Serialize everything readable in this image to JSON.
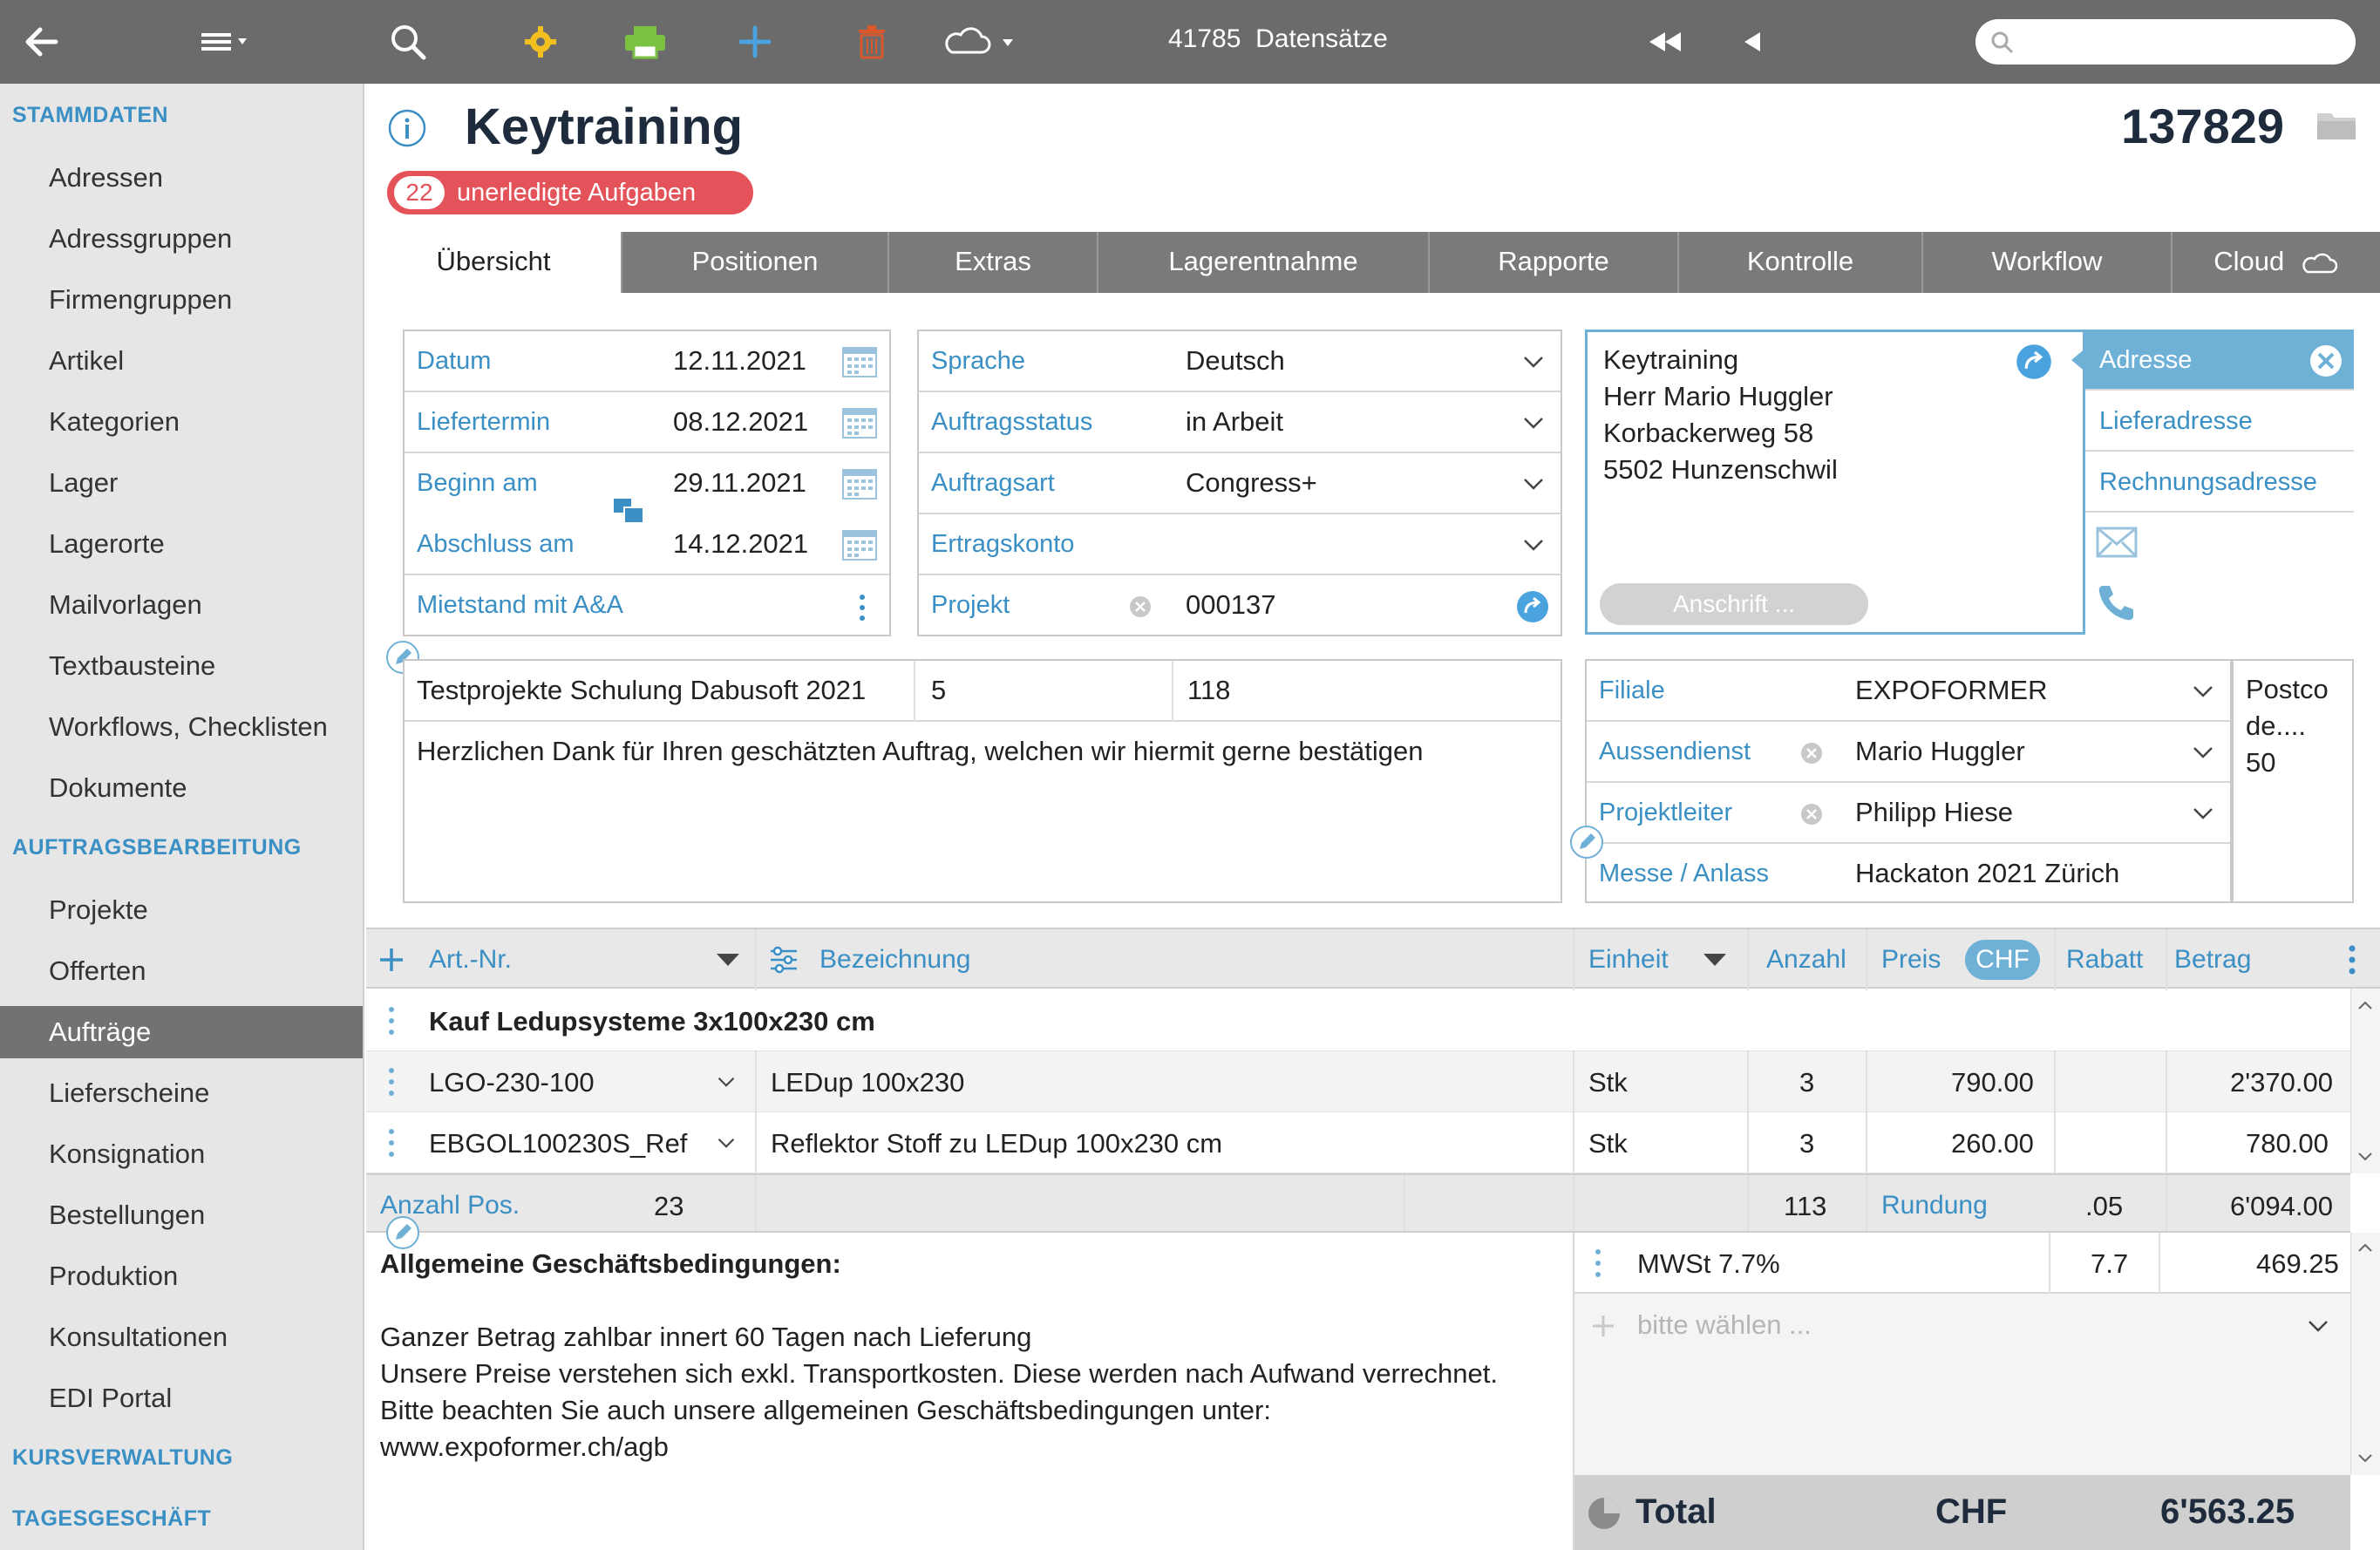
{
  "toolbar": {
    "record_count": "41785",
    "records_label": "Datensätze",
    "search_placeholder": ""
  },
  "sidebar": {
    "sections": [
      {
        "title": "STAMMDATEN",
        "items": [
          "Adressen",
          "Adressgruppen",
          "Firmengruppen",
          "Artikel",
          "Kategorien",
          "Lager",
          "Lagerorte",
          "Mailvorlagen",
          "Textbausteine",
          "Workflows, Checklisten",
          "Dokumente"
        ]
      },
      {
        "title": "AUFTRAGSBEARBEITUNG",
        "items": [
          "Projekte",
          "Offerten",
          "Aufträge",
          "Lieferscheine",
          "Konsignation",
          "Bestellungen",
          "Produktion",
          "Konsultationen",
          "EDI Portal"
        ]
      },
      {
        "title": "KURSVERWALTUNG",
        "items": []
      },
      {
        "title": "TAGESGESCHÄFT",
        "items": []
      }
    ],
    "active_item": "Aufträge"
  },
  "header": {
    "title": "Keytraining",
    "record_id": "137829",
    "tasks_count": "22",
    "tasks_label": "unerledigte Aufgaben"
  },
  "tabs": [
    "Übersicht",
    "Positionen",
    "Extras",
    "Lagerentnahme",
    "Rapporte",
    "Kontrolle",
    "Workflow",
    "Cloud"
  ],
  "dates": [
    {
      "label": "Datum",
      "value": "12.11.2021"
    },
    {
      "label": "Liefertermin",
      "value": "08.12.2021"
    },
    {
      "label": "Beginn am",
      "value": "29.11.2021"
    },
    {
      "label": "Abschluss am",
      "value": "14.12.2021"
    }
  ],
  "mietstand_label": "Mietstand mit A&A",
  "selects": [
    {
      "label": "Sprache",
      "value": "Deutsch"
    },
    {
      "label": "Auftragsstatus",
      "value": "in Arbeit"
    },
    {
      "label": "Auftragsart",
      "value": "Congress+"
    },
    {
      "label": "Ertragskonto",
      "value": ""
    }
  ],
  "projekt": {
    "label": "Projekt",
    "value": "000137"
  },
  "address": {
    "lines": [
      "Keytraining",
      "Herr Mario Huggler",
      "Korbackerweg 58",
      "5502 Hunzenschwil"
    ],
    "button": "Anschrift ...",
    "tabs": [
      "Adresse",
      "Lieferadresse",
      "Rechnungsadresse"
    ]
  },
  "project_line": {
    "name": "Testprojekte Schulung Dabusoft 2021",
    "num1": "5",
    "num2": "118"
  },
  "intro_text": "Herzlichen Dank für Ihren geschätzten Auftrag, welchen wir hiermit gerne bestätigen",
  "staff": [
    {
      "label": "Filiale",
      "value": "EXPOFORMER"
    },
    {
      "label": "Aussendienst",
      "value": "Mario Huggler"
    },
    {
      "label": "Projektleiter",
      "value": "Philipp Hiese"
    },
    {
      "label": "Messe / Anlass",
      "value": "Hackaton 2021 Zürich"
    }
  ],
  "postcode_note": [
    "Postco",
    "de....",
    "50"
  ],
  "positions": {
    "headers": {
      "artnr": "Art.-Nr.",
      "bez": "Bezeichnung",
      "einheit": "Einheit",
      "anzahl": "Anzahl",
      "preis": "Preis",
      "currency": "CHF",
      "rabatt": "Rabatt",
      "betrag": "Betrag"
    },
    "group_title": "Kauf Ledupsysteme 3x100x230 cm",
    "rows": [
      {
        "artnr": "LGO-230-100",
        "bez": "LEDup 100x230",
        "einheit": "Stk",
        "anzahl": "3",
        "preis": "790.00",
        "betrag": "2'370.00"
      },
      {
        "artnr": "EBGOL100230S_Ref",
        "bez": "Reflektor Stoff zu LEDup 100x230 cm",
        "einheit": "Stk",
        "anzahl": "3",
        "preis": "260.00",
        "betrag": "780.00"
      }
    ],
    "footer": {
      "count_label": "Anzahl Pos.",
      "count": "23",
      "qty_total": "113",
      "rundung_label": "Rundung",
      "rundung": ".05",
      "subtotal": "6'094.00"
    }
  },
  "agb": {
    "title": "Allgemeine Geschäftsbedingungen:",
    "lines": [
      "Ganzer Betrag zahlbar innert 60 Tagen nach Lieferung",
      "Unsere Preise verstehen sich exkl. Transportkosten. Diese werden nach Aufwand verrechnet.",
      "Bitte beachten Sie auch unsere allgemeinen Geschäftsbedingungen unter:",
      "www.expoformer.ch/agb"
    ]
  },
  "tax": {
    "label": "MWSt 7.7%",
    "rate": "7.7",
    "amount": "469.25",
    "add_placeholder": "bitte wählen ..."
  },
  "total": {
    "label": "Total",
    "currency": "CHF",
    "amount": "6'563.25"
  },
  "colors": {
    "accent": "#3a8fc4",
    "badge": "#e5535a",
    "topbar": "#6b6b6b",
    "address_border": "#6fb1d6"
  }
}
